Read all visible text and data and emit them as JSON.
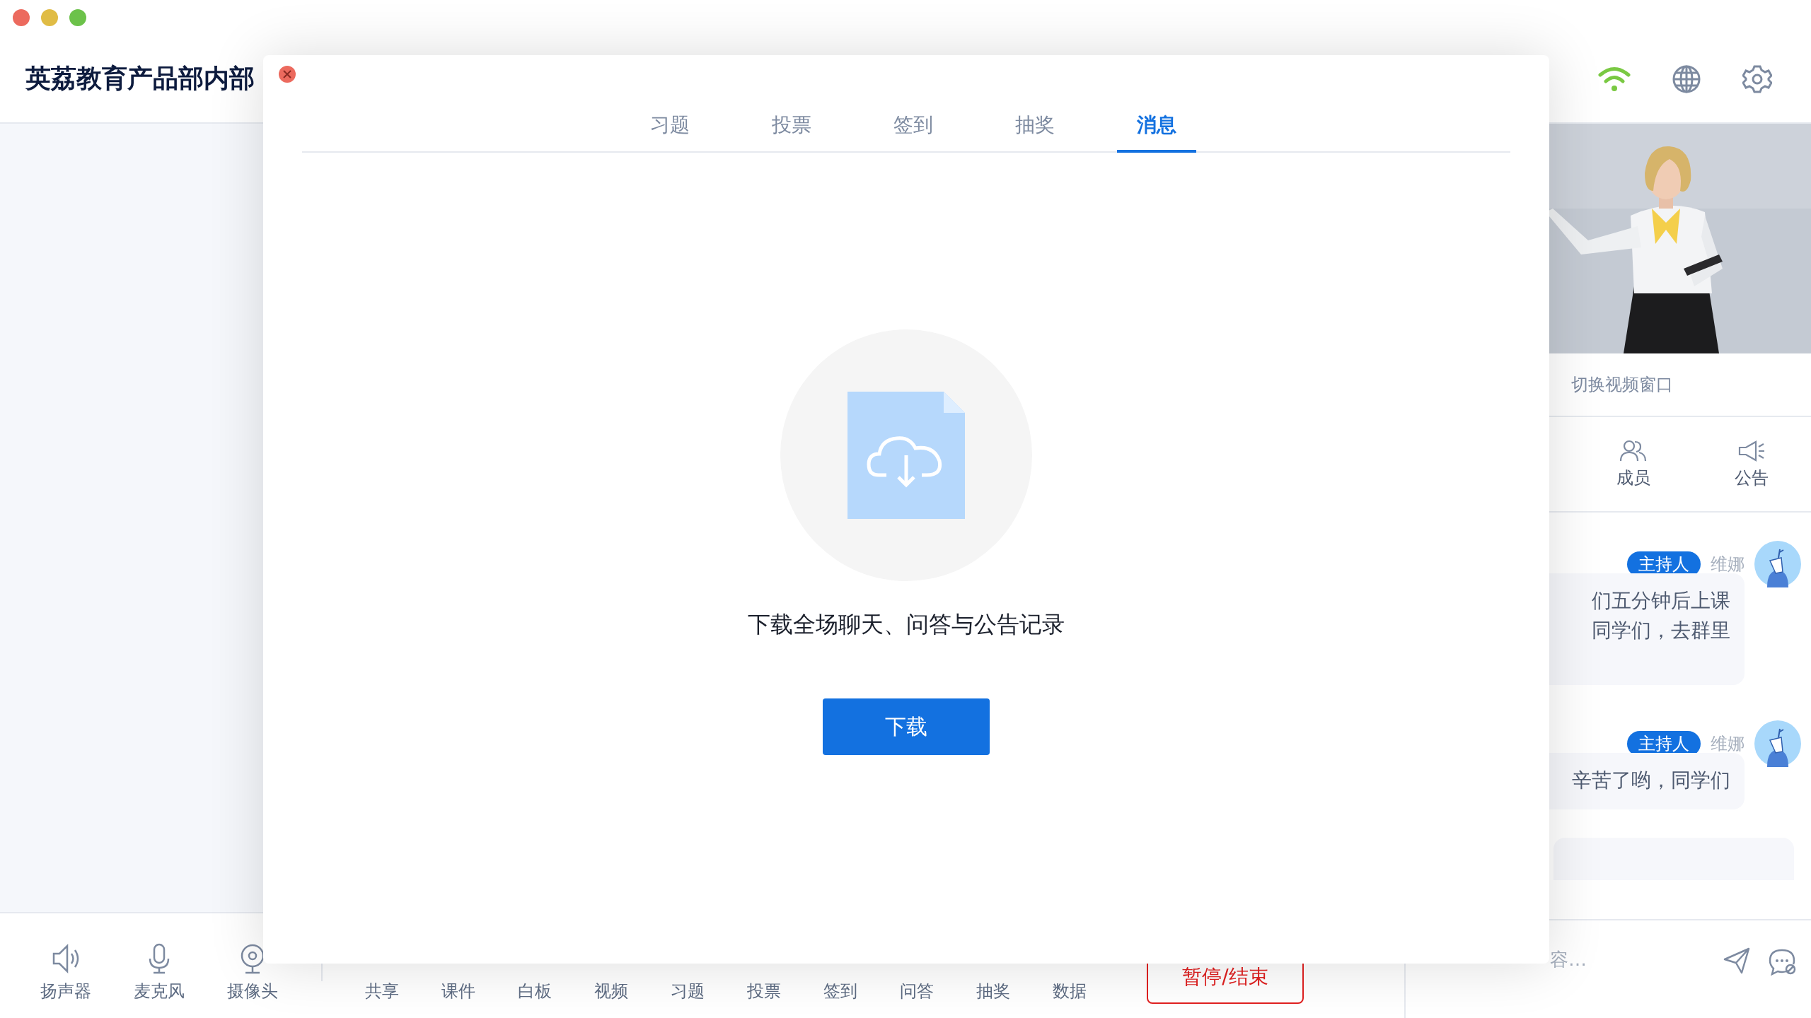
{
  "header": {
    "title": "英荔教育产品部内部"
  },
  "devices": [
    {
      "label": "扬声器",
      "kind": "speaker"
    },
    {
      "label": "麦克风",
      "kind": "mic"
    },
    {
      "label": "摄像头",
      "kind": "camera"
    }
  ],
  "tools": [
    "共享",
    "课件",
    "白板",
    "视频",
    "习题",
    "投票",
    "签到",
    "问答",
    "抽奖",
    "数据"
  ],
  "end_button": "暂停/结束",
  "video_panel": {
    "switch_label": "切换视频窗口"
  },
  "panel_tabs": [
    {
      "label": "成员",
      "kind": "members"
    },
    {
      "label": "公告",
      "kind": "notice"
    }
  ],
  "messages": [
    {
      "role": "主持人",
      "name": "维娜",
      "lines": [
        "们五分钟后上课",
        "同学们，去群里"
      ]
    },
    {
      "role": "主持人",
      "name": "维娜",
      "lines": [
        "辛苦了哟，同学们"
      ]
    }
  ],
  "chat_input": {
    "placeholder": "容…"
  },
  "modal": {
    "tabs": [
      {
        "label": "习题",
        "selected": false
      },
      {
        "label": "投票",
        "selected": false
      },
      {
        "label": "签到",
        "selected": false
      },
      {
        "label": "抽奖",
        "selected": false
      },
      {
        "label": "消息",
        "selected": true
      }
    ],
    "message": "下载全场聊天、问答与公告记录",
    "button": "下载"
  }
}
